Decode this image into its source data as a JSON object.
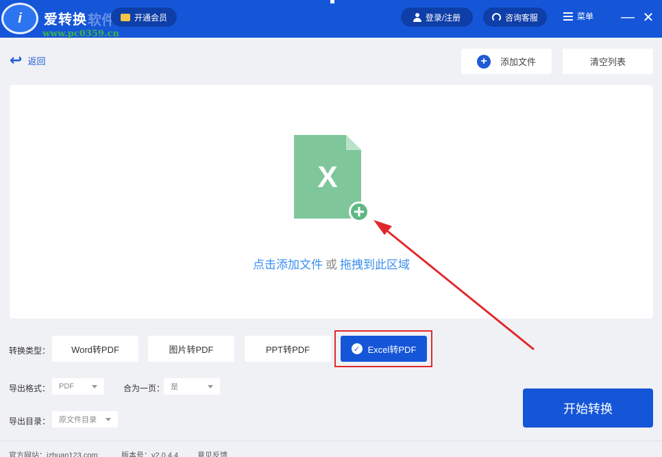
{
  "app": {
    "title": "爱转换",
    "vip_label": "开通会员",
    "watermark_name": "软件园",
    "watermark_url": "www.pc0359.cn"
  },
  "header": {
    "login_label": "登录/注册",
    "service_label": "咨询客服",
    "menu_label": "菜单"
  },
  "toolbar": {
    "back_label": "返回",
    "add_file_label": "添加文件",
    "clear_label": "清空列表"
  },
  "dropzone": {
    "file_letter": "X",
    "add_text": "点击添加文件",
    "or_text": "或",
    "drag_text": "拖拽到此区域"
  },
  "conversion": {
    "label": "转换类型：",
    "types": [
      {
        "label": "Word转PDF"
      },
      {
        "label": "图片转PDF"
      },
      {
        "label": "PPT转PDF"
      },
      {
        "label": "Excel转PDF",
        "selected": true
      }
    ]
  },
  "options": {
    "format_label": "导出格式：",
    "format_value": "PDF",
    "merge_label": "合为一页：",
    "merge_value": "是",
    "dir_label": "导出目录：",
    "dir_value": "原文件目录"
  },
  "actions": {
    "start_label": "开始转换"
  },
  "footer": {
    "site": "官方网站：izhuan123.com",
    "version": "版本号：v2.0.4.4",
    "feedback": "意见反馈"
  },
  "colors": {
    "brand": "#1556d8",
    "excel_green": "#7fc79b",
    "highlight": "#e0282b"
  }
}
